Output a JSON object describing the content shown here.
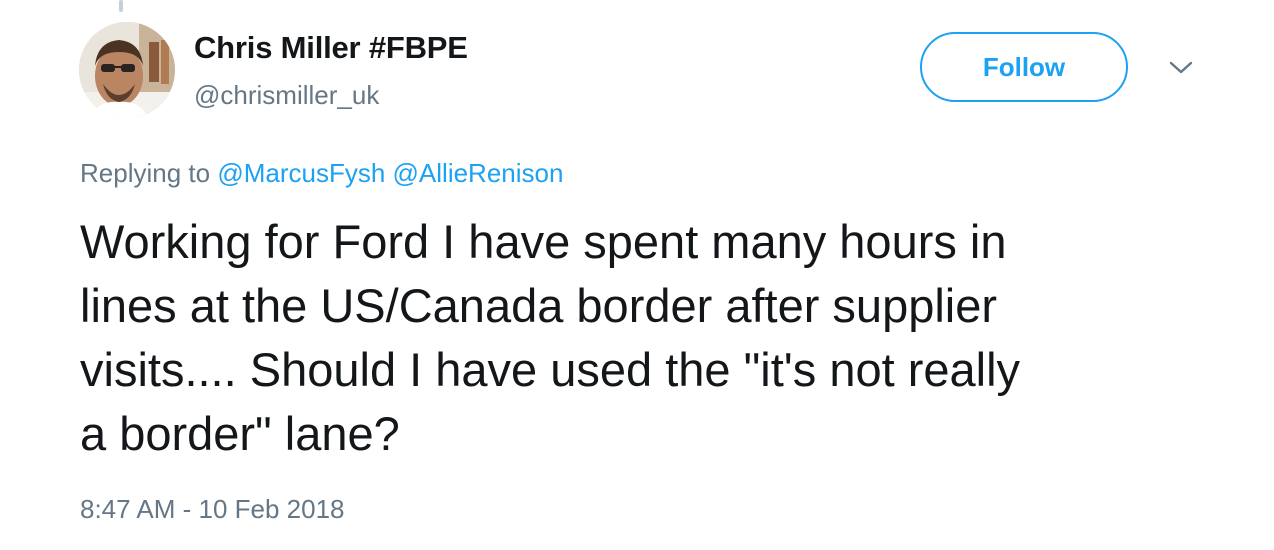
{
  "tweet": {
    "author": {
      "display_name": "Chris Miller #FBPE",
      "handle": "@chrismiller_uk",
      "avatar": "profile-photo"
    },
    "follow_label": "Follow",
    "menu_icon": "chevron-down-icon",
    "replying_to": {
      "prefix": "Replying to",
      "mentions": [
        "@MarcusFysh",
        "@AllieRenison"
      ]
    },
    "text": "Working for Ford I have spent many hours in\nlines at the US/Canada border after supplier\nvisits.... Should I have used the \"it's not really\na border\" lane?",
    "timestamp": "8:47 AM - 10 Feb 2018"
  },
  "colors": {
    "accent": "#1da1f2",
    "text_primary": "#14171a",
    "text_secondary": "#657786"
  }
}
